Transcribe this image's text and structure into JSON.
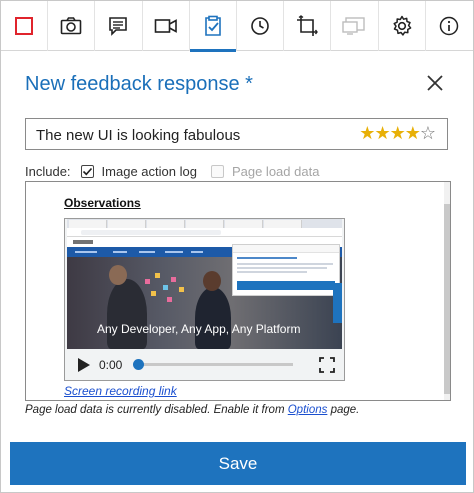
{
  "toolbar": {
    "buttons": [
      {
        "name": "stop-recording",
        "icon": "stop-square-icon",
        "color": "#e0242c"
      },
      {
        "name": "screenshot",
        "icon": "camera-icon"
      },
      {
        "name": "note",
        "icon": "note-icon"
      },
      {
        "name": "video",
        "icon": "video-camera-icon"
      },
      {
        "name": "feedback",
        "icon": "clipboard-check-icon",
        "active": true
      },
      {
        "name": "timeline",
        "icon": "clock-icon"
      },
      {
        "name": "crop",
        "icon": "crop-icon"
      },
      {
        "name": "screens",
        "icon": "screens-icon",
        "disabled": true
      },
      {
        "name": "settings",
        "icon": "gear-icon"
      },
      {
        "name": "info",
        "icon": "info-icon"
      }
    ],
    "accent": "#1e73be"
  },
  "header": {
    "title": "New feedback response *"
  },
  "feedback": {
    "title_value": "The new UI is looking fabulous",
    "rating": 4,
    "rating_max": 5
  },
  "include": {
    "label": "Include:",
    "options": [
      {
        "label": "Image action log",
        "checked": true,
        "disabled": false
      },
      {
        "label": "Page load data",
        "checked": false,
        "disabled": true
      }
    ]
  },
  "editor": {
    "heading": "Observations",
    "video": {
      "time": "0:00",
      "hero_text": "Any Developer, Any App, Any Platform",
      "progress": 0
    },
    "link_text": "Screen recording link"
  },
  "note": {
    "prefix": "Page load data is currently disabled. Enable it from ",
    "link": "Options",
    "suffix": " page."
  },
  "save_label": "Save"
}
